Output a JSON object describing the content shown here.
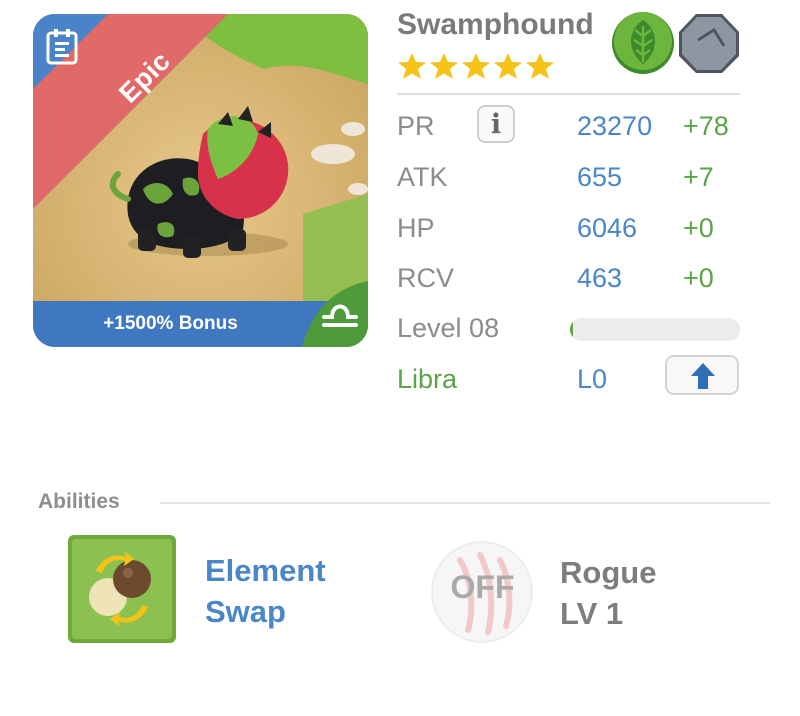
{
  "card": {
    "rarity": "Epic",
    "bonus": "+1500% Bonus",
    "colors": {
      "footer": "#3f78c0",
      "ribbon": "#e06a67",
      "corner": "#4f9a3a"
    }
  },
  "monster": {
    "name": "Swamphound",
    "stars": 5,
    "elements": [
      "leaf-element-icon",
      "stone-element-icon"
    ]
  },
  "stats": [
    {
      "label": "PR",
      "value": "23270",
      "delta": "+78"
    },
    {
      "label": "ATK",
      "value": "655",
      "delta": "+7"
    },
    {
      "label": "HP",
      "value": "6046",
      "delta": "+0"
    },
    {
      "label": "RCV",
      "value": "463",
      "delta": "+0"
    }
  ],
  "level": {
    "label": "Level 08",
    "progress": 0.02
  },
  "zodiac": {
    "label": "Libra",
    "level": "L0"
  },
  "abilities": {
    "title": "Abilities",
    "primary": {
      "name_line1": "Element",
      "name_line2": "Swap"
    },
    "secondary": {
      "status": "OFF",
      "name": "Rogue",
      "level": "LV 1"
    }
  }
}
